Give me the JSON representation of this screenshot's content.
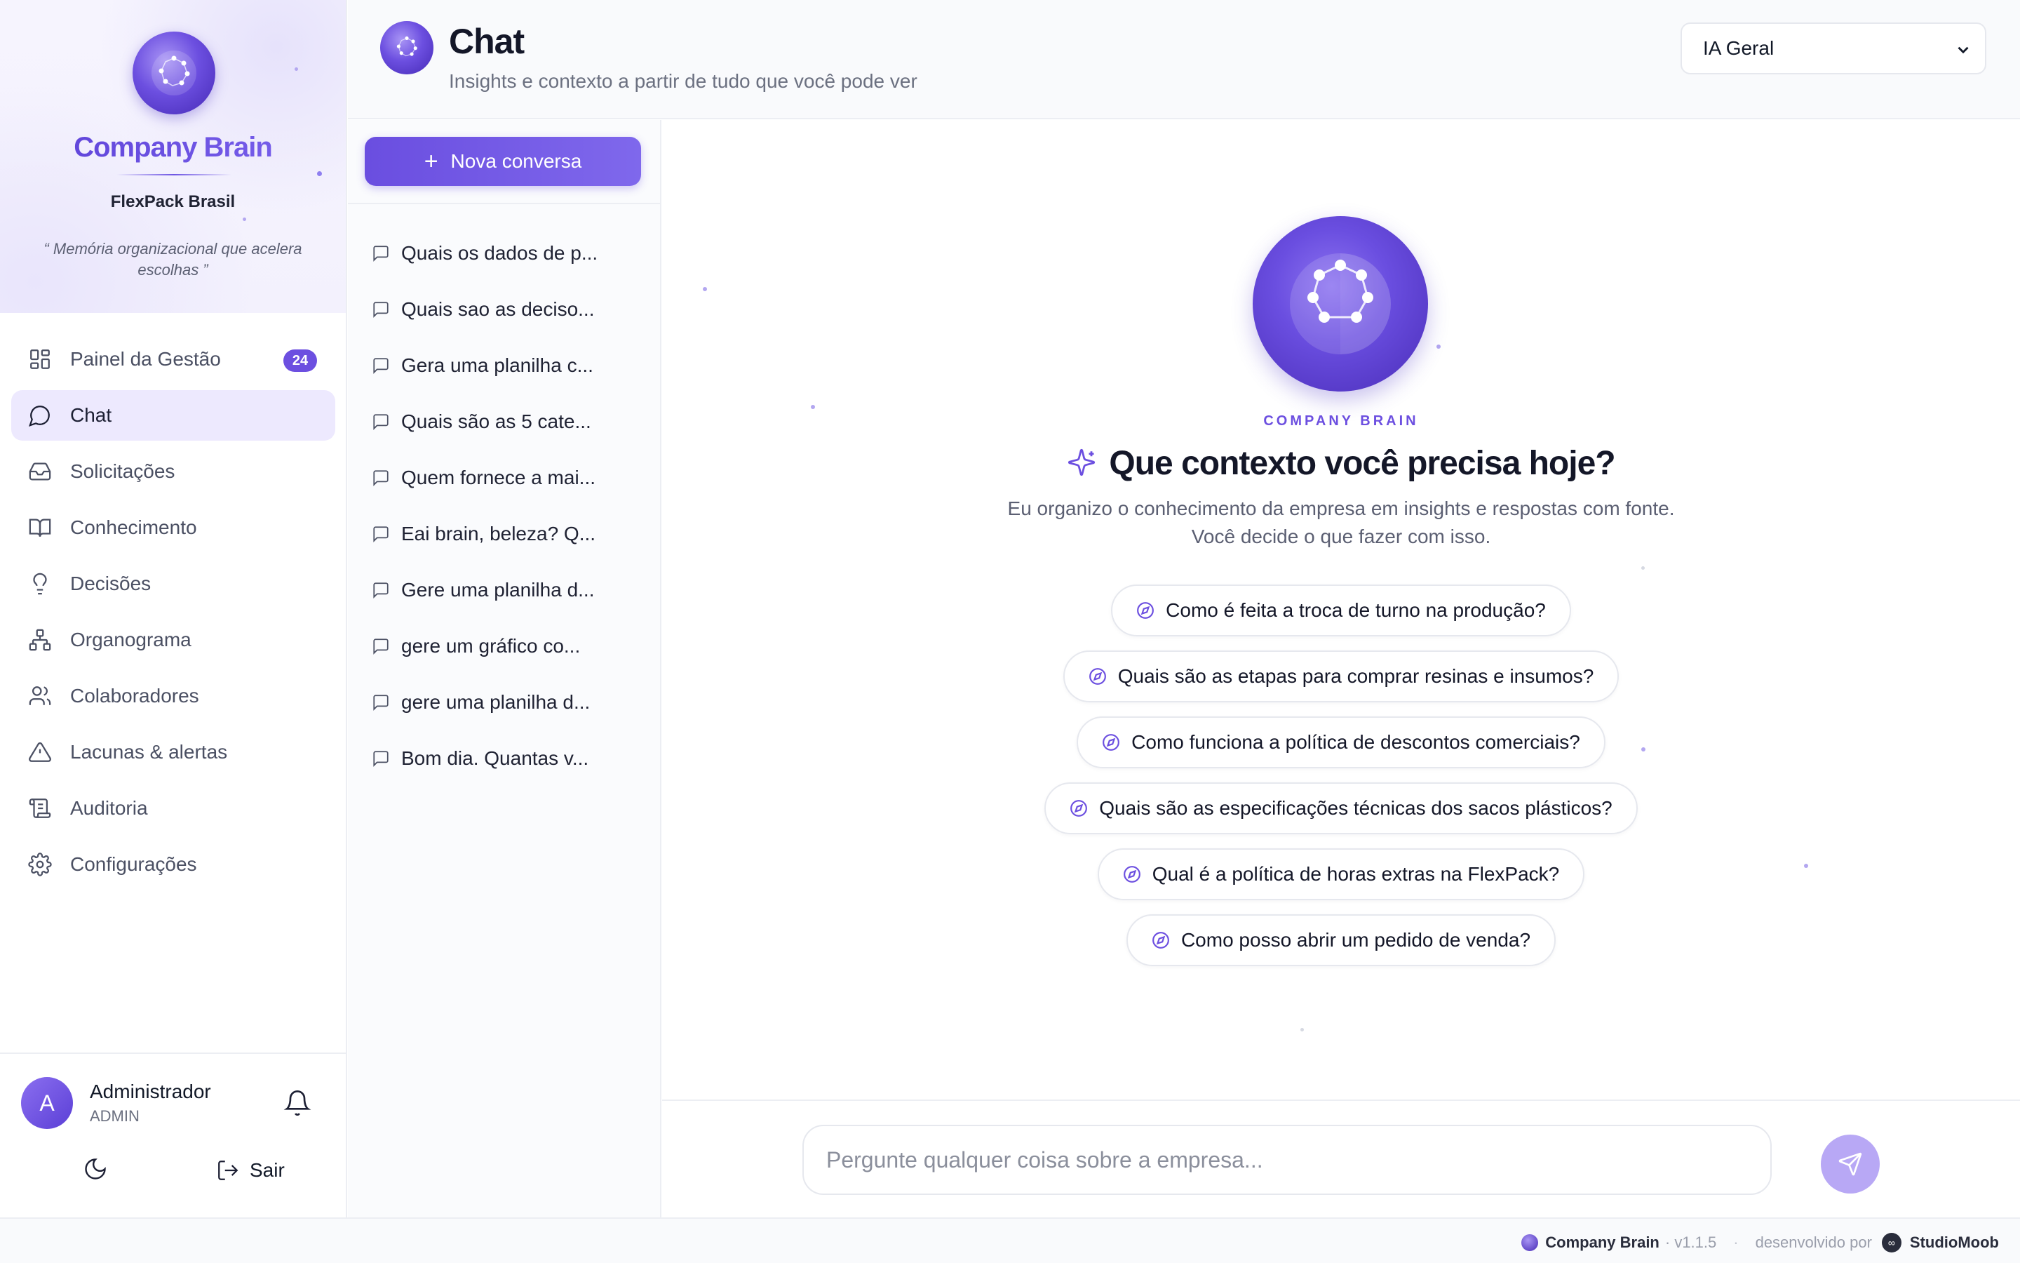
{
  "brand": {
    "name": "Company Brain",
    "company": "FlexPack Brasil",
    "tagline": "“ Memória organizacional que acelera escolhas ”"
  },
  "nav": {
    "items": [
      {
        "label": "Painel da Gestão",
        "icon": "dashboard-icon",
        "badge": "24"
      },
      {
        "label": "Chat",
        "icon": "chat-bubble-icon",
        "active": true
      },
      {
        "label": "Solicitações",
        "icon": "inbox-icon"
      },
      {
        "label": "Conhecimento",
        "icon": "book-icon"
      },
      {
        "label": "Decisões",
        "icon": "lightbulb-icon"
      },
      {
        "label": "Organograma",
        "icon": "org-chart-icon"
      },
      {
        "label": "Colaboradores",
        "icon": "users-icon"
      },
      {
        "label": "Lacunas & alertas",
        "icon": "warning-icon"
      },
      {
        "label": "Auditoria",
        "icon": "scroll-icon"
      },
      {
        "label": "Configurações",
        "icon": "gear-icon"
      }
    ]
  },
  "user": {
    "initial": "A",
    "name": "Administrador",
    "role": "ADMIN",
    "logout_label": "Sair"
  },
  "header": {
    "title": "Chat",
    "subtitle": "Insights e contexto a partir de tudo que você pode ver",
    "model_select": "IA Geral"
  },
  "conversations": {
    "new_label": "Nova conversa",
    "items": [
      "Quais os dados de p...",
      "Quais sao as deciso...",
      "Gera uma planilha c...",
      "Quais são as 5 cate...",
      "Quem fornece a mai...",
      "Eai brain, beleza? Q...",
      "Gere uma planilha d...",
      "gere um gráfico co...",
      "gere uma planilha d...",
      "Bom dia. Quantas v..."
    ]
  },
  "hero": {
    "eyebrow": "COMPANY BRAIN",
    "title": "Que contexto você precisa hoje?",
    "subtitle_line1": "Eu organizo o conhecimento da empresa em insights e respostas com fonte.",
    "subtitle_line2": "Você decide o que fazer com isso."
  },
  "suggestions": [
    "Como é feita a troca de turno na produção?",
    "Quais são as etapas para comprar resinas e insumos?",
    "Como funciona a política de descontos comerciais?",
    "Quais são as especificações técnicas dos sacos plásticos?",
    "Qual é a política de horas extras na FlexPack?",
    "Como posso abrir um pedido de venda?"
  ],
  "composer": {
    "placeholder": "Pergunte qualquer coisa sobre a empresa..."
  },
  "footer": {
    "app": "Company Brain",
    "version": "· v1.1.5",
    "dev_label": "desenvolvido por",
    "dev_name": "StudioMoob"
  },
  "colors": {
    "accent": "#6c4fe0",
    "accent_light": "#ede9fe",
    "text": "#141728",
    "muted": "#6b7080"
  }
}
